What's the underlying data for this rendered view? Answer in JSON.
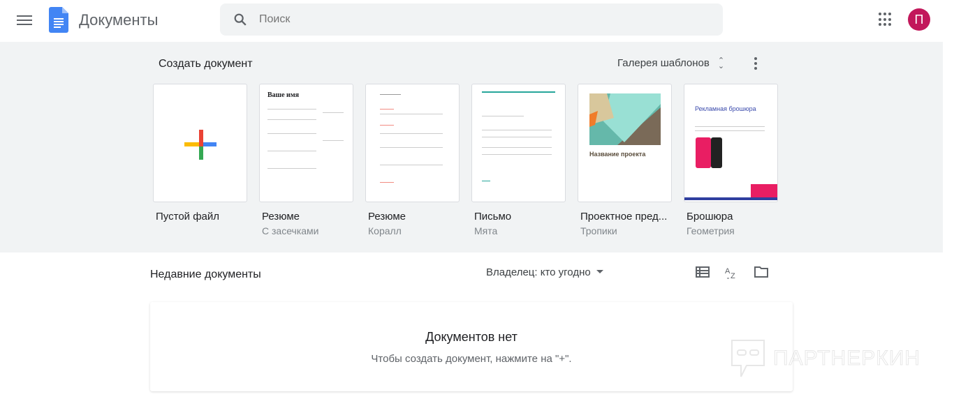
{
  "header": {
    "app_title": "Документы",
    "search_placeholder": "Поиск",
    "avatar_letter": "П"
  },
  "gallery": {
    "create_label": "Создать документ",
    "gallery_button": "Галерея шаблонов",
    "templates": [
      {
        "name": "Пустой файл",
        "sub": ""
      },
      {
        "name": "Резюме",
        "sub": "С засечками",
        "thumb_heading": "Ваше имя"
      },
      {
        "name": "Резюме",
        "sub": "Коралл"
      },
      {
        "name": "Письмо",
        "sub": "Мята"
      },
      {
        "name": "Проектное пред...",
        "sub": "Тропики",
        "thumb_heading": "Название проекта"
      },
      {
        "name": "Брошюра",
        "sub": "Геометрия",
        "thumb_heading": "Рекламная брошюра"
      }
    ]
  },
  "recent": {
    "title": "Недавние документы",
    "owner_filter": "Владелец: кто угодно",
    "empty_title": "Документов нет",
    "empty_subtitle": "Чтобы создать документ, нажмите на \"+\"."
  },
  "watermark": "ПАРТНЕРКИН"
}
